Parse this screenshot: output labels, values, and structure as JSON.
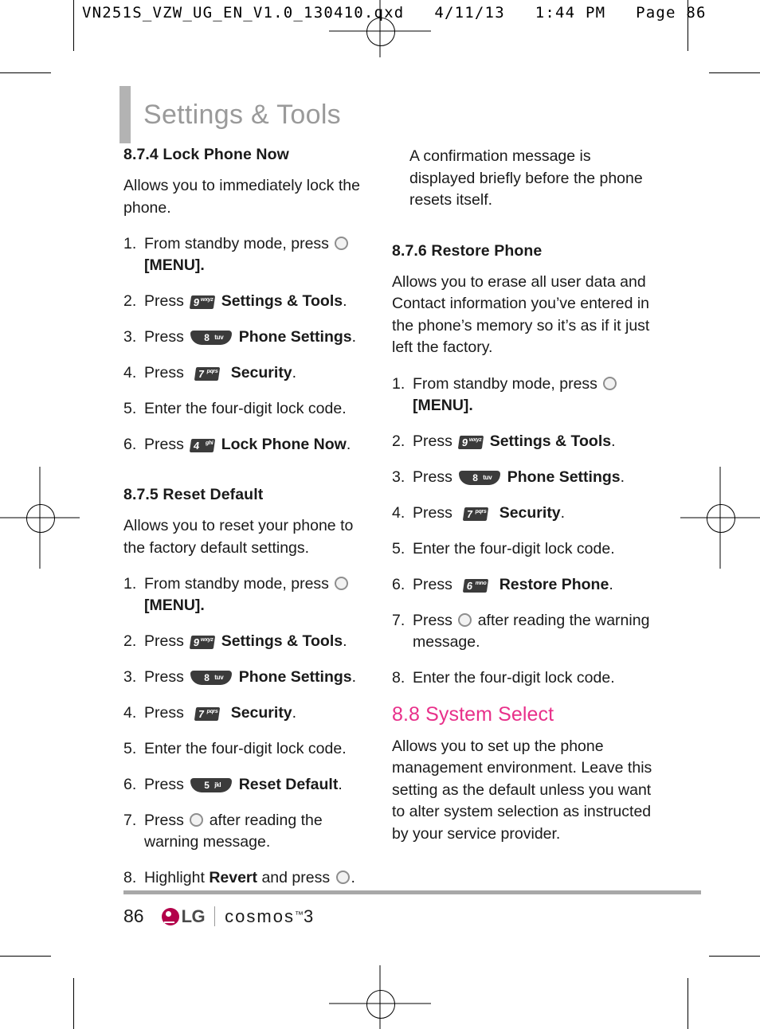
{
  "slug": {
    "text": "VN251S_VZW_UG_EN_V1.0_130410.qxd   4/11/13   1:44 PM   Page 86"
  },
  "chapter": {
    "title": "Settings & Tools",
    "accent_color": "#e8308a",
    "title_color": "#9a9a9a"
  },
  "left_column": {
    "s874": {
      "heading": "8.7.4 Lock Phone Now",
      "intro": "Allows you to immediately lock the phone.",
      "steps": [
        {
          "num": "1.",
          "pre": "From standby mode, press",
          "icon": "ok-key-icon",
          "post": "[MENU].",
          "post_bold": ""
        },
        {
          "num": "2.",
          "pre": "Press",
          "icon": "key-9-wxyz",
          "key_digit": "9",
          "key_letters": "wxyz",
          "bold": "Settings & Tools",
          "post": "."
        },
        {
          "num": "3.",
          "pre": "Press",
          "icon": "key-8-tuv",
          "key_digit": "8",
          "key_letters": "tuv",
          "bold": "Phone Settings",
          "post": "."
        },
        {
          "num": "4.",
          "pre": "Press",
          "icon": "key-7-pqrs",
          "key_digit": "7",
          "key_letters": "pqrs",
          "bold": "Security",
          "post": "."
        },
        {
          "num": "5.",
          "pre": "Enter the four-digit lock code.",
          "icon": ""
        },
        {
          "num": "6.",
          "pre": "Press",
          "icon": "key-4-ghi",
          "key_digit": "4",
          "key_letters": "ghi",
          "bold": "Lock Phone Now",
          "post": "."
        }
      ]
    },
    "s875": {
      "heading": "8.7.5 Reset Default",
      "intro": "Allows you to reset your phone to the factory default settings.",
      "steps": [
        {
          "num": "1.",
          "pre": "From standby mode, press",
          "icon": "ok-key-icon",
          "post": "[MENU]."
        },
        {
          "num": "2.",
          "pre": "Press",
          "icon": "key-9-wxyz",
          "key_digit": "9",
          "key_letters": "wxyz",
          "bold": "Settings & Tools",
          "post": "."
        },
        {
          "num": "3.",
          "pre": "Press",
          "icon": "key-8-tuv",
          "key_digit": "8",
          "key_letters": "tuv",
          "bold": "Phone Settings",
          "post": "."
        },
        {
          "num": "4.",
          "pre": "Press",
          "icon": "key-7-pqrs",
          "key_digit": "7",
          "key_letters": "pqrs",
          "bold": "Security",
          "post": "."
        },
        {
          "num": "5.",
          "pre": "Enter the four-digit lock code.",
          "icon": ""
        },
        {
          "num": "6.",
          "pre": "Press",
          "icon": "key-5-jkl",
          "key_digit": "5",
          "key_letters": "jkl",
          "bold": "Reset Default",
          "post": "."
        },
        {
          "num": "7.",
          "pre": "Press",
          "icon": "ok-key-icon",
          "post": "after reading the warning message."
        },
        {
          "num": "8.",
          "pre": "Highlight",
          "bold": "Revert",
          "mid": "and press",
          "icon": "ok-key-icon",
          "post": "."
        }
      ]
    }
  },
  "right_column": {
    "continuation": "A confirmation message is displayed briefly before the phone resets itself.",
    "s876": {
      "heading": "8.7.6 Restore Phone",
      "intro": "Allows you to erase all user data and Contact information you’ve entered in the phone’s memory so it’s as if it just left the factory.",
      "steps": [
        {
          "num": "1.",
          "pre": "From standby mode, press",
          "icon": "ok-key-icon",
          "post": "[MENU]."
        },
        {
          "num": "2.",
          "pre": "Press",
          "icon": "key-9-wxyz",
          "key_digit": "9",
          "key_letters": "wxyz",
          "bold": "Settings & Tools",
          "post": "."
        },
        {
          "num": "3.",
          "pre": "Press",
          "icon": "key-8-tuv",
          "key_digit": "8",
          "key_letters": "tuv",
          "bold": "Phone Settings",
          "post": "."
        },
        {
          "num": "4.",
          "pre": "Press",
          "icon": "key-7-pqrs",
          "key_digit": "7",
          "key_letters": "pqrs",
          "bold": "Security",
          "post": "."
        },
        {
          "num": "5.",
          "pre": "Enter the four-digit lock code.",
          "icon": ""
        },
        {
          "num": "6.",
          "pre": "Press",
          "icon": "key-6-mno",
          "key_digit": "6",
          "key_letters": "mno",
          "bold": "Restore Phone",
          "post": "."
        },
        {
          "num": "7.",
          "pre": "Press",
          "icon": "ok-key-icon",
          "post": "after reading the warning message."
        },
        {
          "num": "8.",
          "pre": "Enter the four-digit lock code.",
          "icon": ""
        }
      ]
    },
    "s88": {
      "heading": "8.8 System Select",
      "intro": "Allows you to set up the phone management environment. Leave this setting as the default unless you want to alter system selection as instructed by your service provider."
    }
  },
  "footer": {
    "page_number": "86",
    "brand": "LG",
    "product": "cosmos",
    "trademark": "™",
    "model": "3"
  }
}
